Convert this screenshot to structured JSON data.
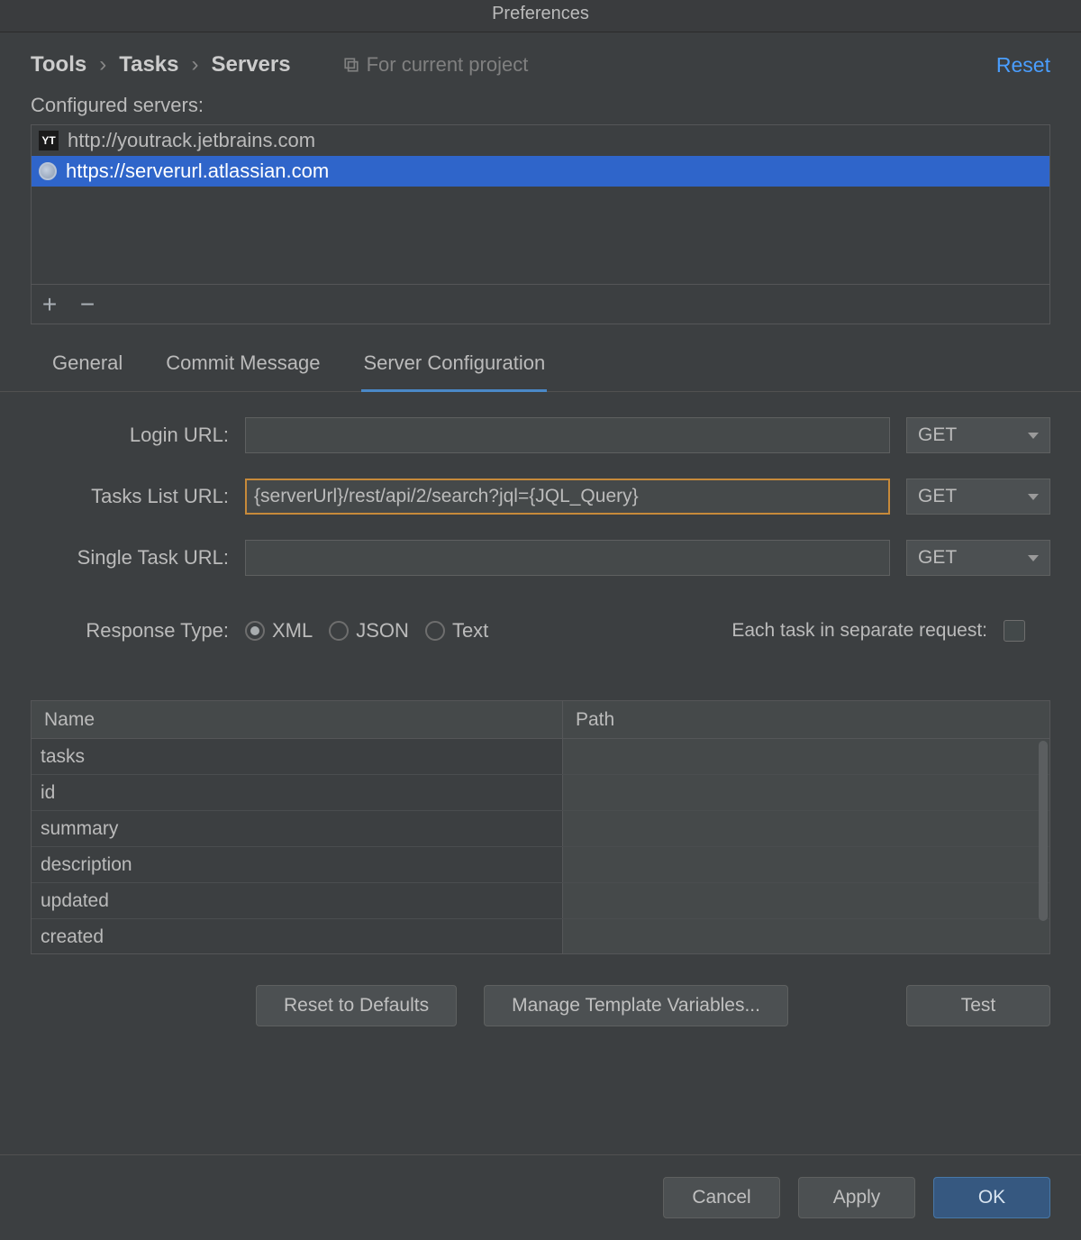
{
  "window": {
    "title": "Preferences"
  },
  "breadcrumb": {
    "items": [
      "Tools",
      "Tasks",
      "Servers"
    ]
  },
  "scope": {
    "label": "For current project"
  },
  "reset": {
    "label": "Reset"
  },
  "servers": {
    "section_label": "Configured servers:",
    "items": [
      {
        "url": "http://youtrack.jetbrains.com",
        "icon": "youtrack",
        "selected": false
      },
      {
        "url": "https://serverurl.atlassian.com",
        "icon": "globe",
        "selected": true
      }
    ],
    "add_label": "+",
    "remove_label": "−"
  },
  "tabs": {
    "items": [
      {
        "label": "General",
        "active": false
      },
      {
        "label": "Commit Message",
        "active": false
      },
      {
        "label": "Server Configuration",
        "active": true
      }
    ]
  },
  "form": {
    "login_url": {
      "label": "Login URL:",
      "value": "",
      "method": "GET"
    },
    "tasks_list_url": {
      "label": "Tasks List URL:",
      "value": "{serverUrl}/rest/api/2/search?jql={JQL_Query}",
      "method": "GET"
    },
    "single_task_url": {
      "label": "Single Task URL:",
      "value": "",
      "method": "GET"
    }
  },
  "response": {
    "label": "Response Type:",
    "options": [
      "XML",
      "JSON",
      "Text"
    ],
    "selected": "XML",
    "each_task_label": "Each task in separate request:",
    "each_task_checked": false
  },
  "table": {
    "columns": [
      "Name",
      "Path"
    ],
    "rows": [
      {
        "name": "tasks",
        "path": ""
      },
      {
        "name": "id",
        "path": ""
      },
      {
        "name": "summary",
        "path": ""
      },
      {
        "name": "description",
        "path": ""
      },
      {
        "name": "updated",
        "path": ""
      },
      {
        "name": "created",
        "path": ""
      }
    ]
  },
  "actions": {
    "reset_defaults": "Reset to Defaults",
    "manage_vars": "Manage Template Variables...",
    "test": "Test"
  },
  "footer": {
    "cancel": "Cancel",
    "apply": "Apply",
    "ok": "OK"
  }
}
